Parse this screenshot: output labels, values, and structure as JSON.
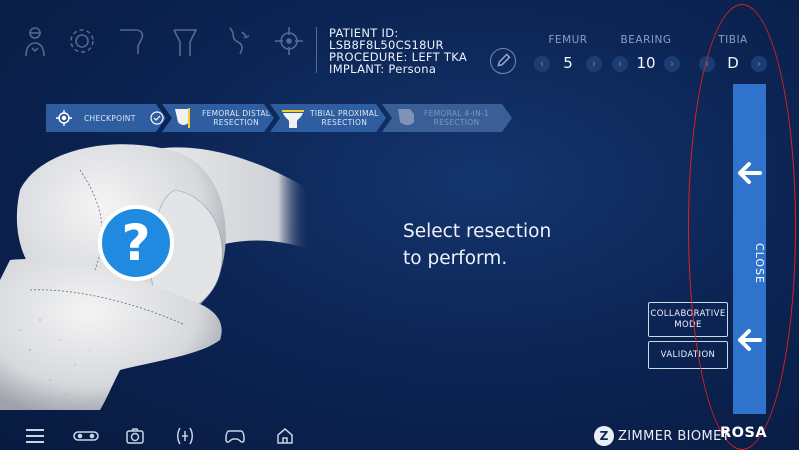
{
  "header": {
    "tools": [
      {
        "icon": "surgeon-icon"
      },
      {
        "icon": "settings-gear-icon"
      },
      {
        "icon": "knee-bend-icon"
      },
      {
        "icon": "leg-alignment-icon"
      },
      {
        "icon": "ligament-icon"
      },
      {
        "icon": "target-icon"
      }
    ],
    "patient_line": "PATIENT ID: LSB8F8L50CS18UR",
    "procedure_line": "PROCEDURE: LEFT TKA",
    "implant_line": "IMPLANT: Persona"
  },
  "selectors": [
    {
      "label": "FEMUR",
      "value": "5"
    },
    {
      "label": "BEARING",
      "value": "10"
    },
    {
      "label": "TIBIA",
      "value": "D"
    }
  ],
  "workflow": {
    "steps": [
      {
        "label": "CHECKPOINT"
      },
      {
        "label_line1": "FEMORAL DISTAL",
        "label_line2": "RESECTION"
      },
      {
        "label_line1": "TIBIAL PROXIMAL",
        "label_line2": "RESECTION"
      },
      {
        "label_line1": "FEMORAL 4-IN-1",
        "label_line2": "RESECTION"
      }
    ]
  },
  "main": {
    "prompt_line1": "Select resection",
    "prompt_line2": "to perform.",
    "help_symbol": "?"
  },
  "side_buttons": {
    "collaborative_line1": "COLLABORATIVE",
    "collaborative_line2": "MODE",
    "validation": "VALIDATION"
  },
  "close_panel": {
    "label": "CLOSE"
  },
  "footer": {
    "icons": [
      "menu-icon",
      "tracker-icon",
      "camera-icon",
      "foot-pedal-icon",
      "gamepad-icon",
      "home-icon"
    ],
    "brand_name": "ZIMMER BIOMET",
    "brand_logo_letter": "Z",
    "product_name": "ROSA"
  },
  "colors": {
    "background": "#0c2555",
    "breadcrumb": "#2f5ea0",
    "close_panel": "#2f73cc",
    "help_badge": "#1f8ae0",
    "annotation_ring": "#e0201f"
  }
}
